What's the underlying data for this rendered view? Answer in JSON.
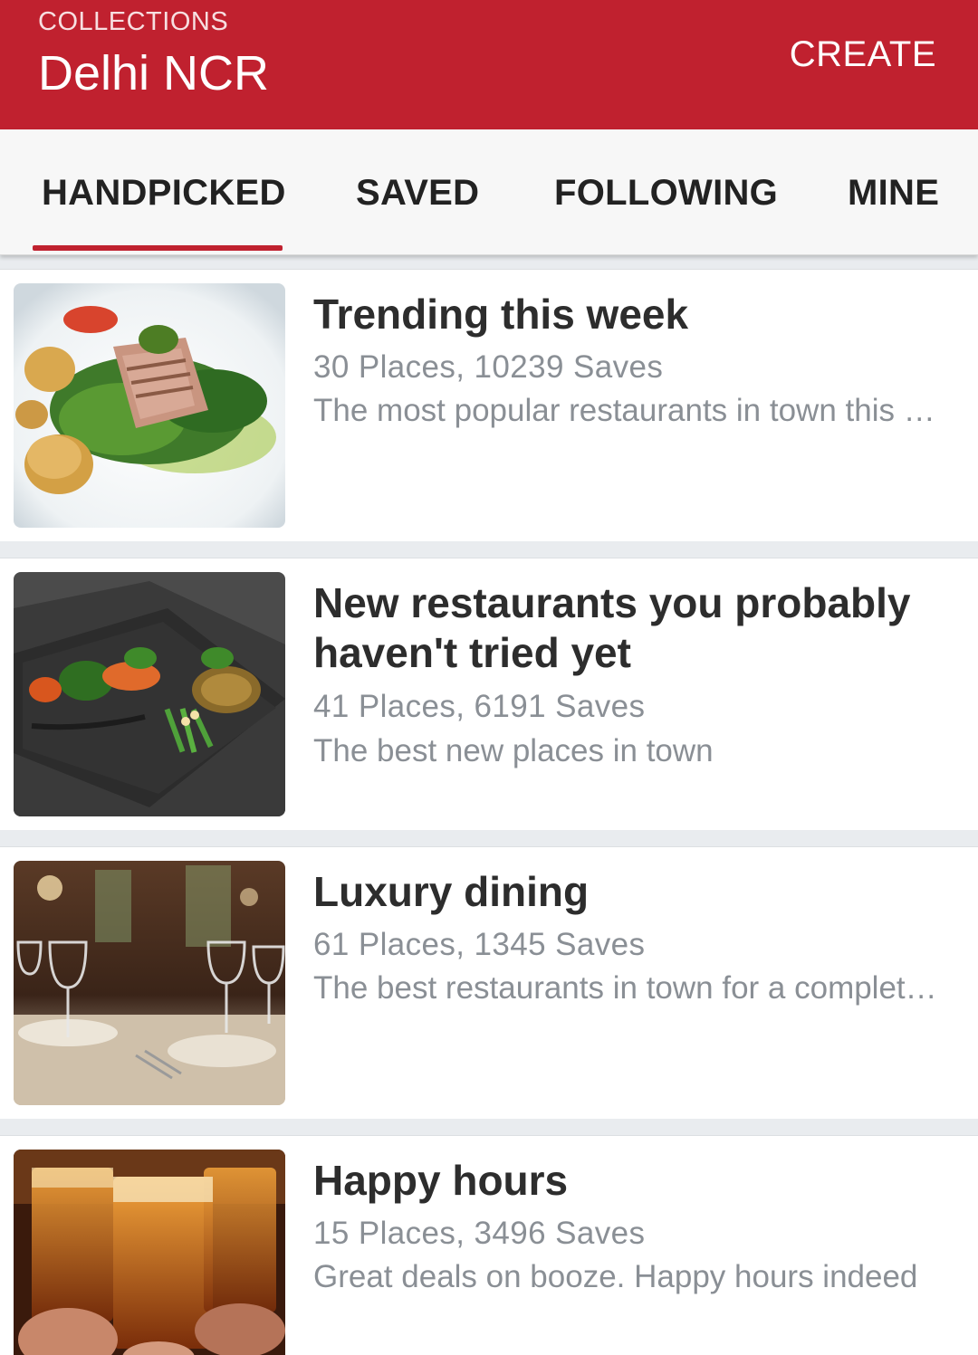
{
  "header": {
    "overline": "COLLECTIONS",
    "city": "Delhi NCR",
    "create_label": "CREATE",
    "color": "#c0212f"
  },
  "tabs": [
    {
      "label": "HANDPICKED",
      "active": true
    },
    {
      "label": "SAVED",
      "active": false
    },
    {
      "label": "FOLLOWING",
      "active": false
    },
    {
      "label": "MINE",
      "active": false
    }
  ],
  "collections": [
    {
      "title": "Trending this week",
      "meta": "30 Places, 10239 Saves",
      "description": "The most popular restaurants in town this week",
      "image": "plated-fish-salad-photo"
    },
    {
      "title": "New restaurants you probably haven't tried yet",
      "meta": "41 Places, 6191 Saves",
      "description": "The best new places in town",
      "image": "slate-plate-appetizers-photo"
    },
    {
      "title": "Luxury dining",
      "meta": "61 Places, 1345 Saves",
      "description": "The best restaurants in town for a complete fine dining experience",
      "image": "wine-glasses-table-photo"
    },
    {
      "title": "Happy hours",
      "meta": "15 Places, 3496 Saves",
      "description": "Great deals on booze. Happy hours indeed",
      "image": "beer-glasses-cheers-photo"
    }
  ]
}
